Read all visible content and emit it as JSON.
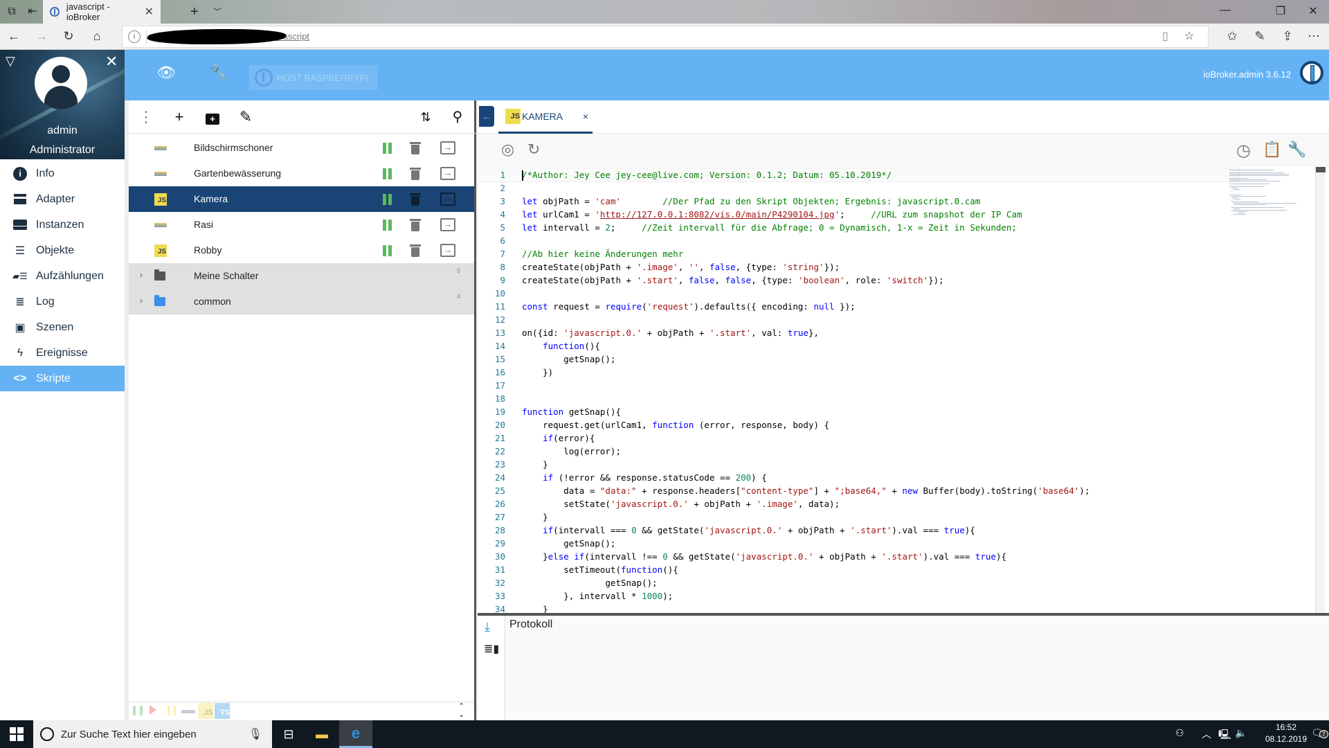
{
  "browser": {
    "tab_title": "javascript - ioBroker",
    "url_visible_suffix": "javascript",
    "icons": [
      "tab-list-icon",
      "tab-aside-icon",
      "new-tab-icon",
      "tab-dropdown-icon",
      "back-icon",
      "forward-icon",
      "refresh-icon",
      "home-icon",
      "site-info-icon",
      "reading-view-icon",
      "favorite-star-icon",
      "favorites-list-icon",
      "pen-icon",
      "share-icon",
      "more-icon"
    ],
    "window_controls": [
      "minimize",
      "restore",
      "close"
    ]
  },
  "header": {
    "host_button": "HOST RASPBERRYPI",
    "version": "ioBroker.admin 3.6.12"
  },
  "drawer": {
    "user_name": "admin",
    "user_role": "Administrator",
    "items": [
      {
        "label": "Info",
        "icon": "info-icon"
      },
      {
        "label": "Adapter",
        "icon": "store-icon"
      },
      {
        "label": "Instanzen",
        "icon": "instances-icon"
      },
      {
        "label": "Objekte",
        "icon": "list-icon"
      },
      {
        "label": "Aufzählungen",
        "icon": "enums-icon"
      },
      {
        "label": "Log",
        "icon": "log-icon"
      },
      {
        "label": "Szenen",
        "icon": "scenes-icon"
      },
      {
        "label": "Ereignisse",
        "icon": "lightning-icon"
      },
      {
        "label": "Skripte",
        "icon": "code-icon",
        "active": true
      }
    ]
  },
  "scripts": {
    "items": [
      {
        "name": "Bildschirmschoner",
        "type": "blockly"
      },
      {
        "name": "Gartenbewässerung",
        "type": "blockly"
      },
      {
        "name": "Kamera",
        "type": "js",
        "selected": true
      },
      {
        "name": "Rasi",
        "type": "blockly"
      },
      {
        "name": "Robby",
        "type": "js"
      }
    ],
    "folders": [
      {
        "name": "Meine Schalter",
        "count": "5",
        "color": "#555555"
      },
      {
        "name": "common",
        "count": "4",
        "color": "#3b8eea"
      }
    ],
    "js_badge": "JS",
    "ts_badge": "TS"
  },
  "editor": {
    "tab_label": "KAMERA",
    "tab_close": "×",
    "log_title": "Protokoll",
    "code_lines": [
      "/*Author: Jey Cee jey-cee@live.com; Version: 0.1.2; Datum: 05.10.2019*/",
      "",
      "let objPath = 'cam'        //Der Pfad zu den Skript Objekten; Ergebnis: javascript.0.cam",
      "let urlCam1 = 'http://127.0.0.1:8082/vis.0/main/P4290104.jpg';     //URL zum snapshot der IP Cam",
      "let intervall = 2;     //Zeit intervall für die Abfrage; 0 = Dynamisch, 1-x = Zeit in Sekunden;",
      "",
      "//Ab hier keine Änderungen mehr",
      "createState(objPath + '.image', '', false, {type: 'string'});",
      "createState(objPath + '.start', false, false, {type: 'boolean', role: 'switch'});",
      "",
      "const request = require('request').defaults({ encoding: null });",
      "",
      "on({id: 'javascript.0.' + objPath + '.start', val: true},",
      "    function(){",
      "        getSnap();",
      "    })",
      "",
      "",
      "function getSnap(){",
      "    request.get(urlCam1, function (error, response, body) {",
      "    if(error){",
      "        log(error);",
      "    }",
      "    if (!error && response.statusCode == 200) {",
      "        data = \"data:\" + response.headers[\"content-type\"] + \";base64,\" + new Buffer(body).toString('base64');",
      "        setState('javascript.0.' + objPath + '.image', data);",
      "    }",
      "    if(intervall === 0 && getState('javascript.0.' + objPath + '.start').val === true){",
      "        getSnap();",
      "    }else if(intervall !== 0 && getState('javascript.0.' + objPath + '.start').val === true){",
      "        setTimeout(function(){",
      "                getSnap();",
      "        }, intervall * 1000);",
      "    }"
    ]
  },
  "taskbar": {
    "search_placeholder": "Zur Suche Text hier eingeben",
    "time": "16:52",
    "date": "08.12.2019",
    "notification_count": "7"
  },
  "colors": {
    "header_blue": "#64b2f4",
    "selected_navy": "#194475",
    "running_green": "#5cb85c",
    "fab_red": "#ff7777"
  }
}
